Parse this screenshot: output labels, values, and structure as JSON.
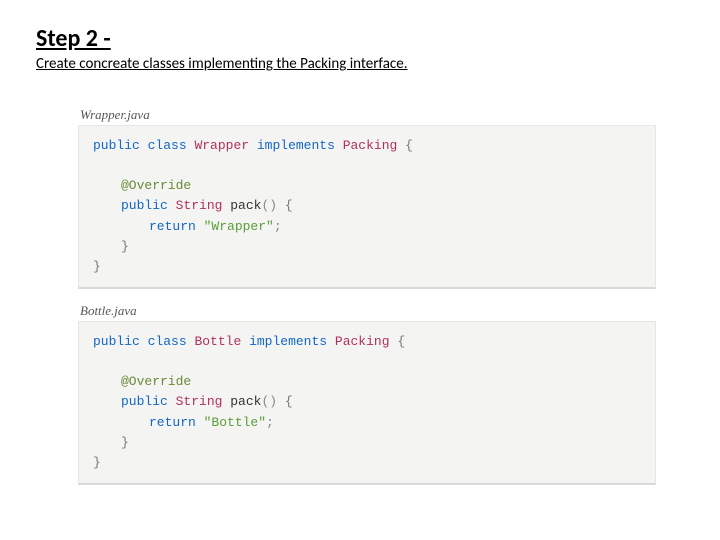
{
  "heading": "Step 2 -",
  "subheading": "Create concreate classes implementing the Packing interface.",
  "files": [
    {
      "name": "Wrapper.java",
      "tokens": {
        "kw_public": "public",
        "kw_class": "class",
        "cls_name": "Wrapper",
        "kw_implements": "implements",
        "iface": "Packing",
        "lbrace": "{",
        "anno": "@Override",
        "kw_public2": "public",
        "type_string": "String",
        "method": "pack",
        "parens": "()",
        "lbrace2": "{",
        "kw_return": "return",
        "str_lit": "\"Wrapper\"",
        "semi": ";",
        "rbrace2": "}",
        "rbrace": "}"
      }
    },
    {
      "name": "Bottle.java",
      "tokens": {
        "kw_public": "public",
        "kw_class": "class",
        "cls_name": "Bottle",
        "kw_implements": "implements",
        "iface": "Packing",
        "lbrace": "{",
        "anno": "@Override",
        "kw_public2": "public",
        "type_string": "String",
        "method": "pack",
        "parens": "()",
        "lbrace2": "{",
        "kw_return": "return",
        "str_lit": "\"Bottle\"",
        "semi": ";",
        "rbrace2": "}",
        "rbrace": "}"
      }
    }
  ]
}
